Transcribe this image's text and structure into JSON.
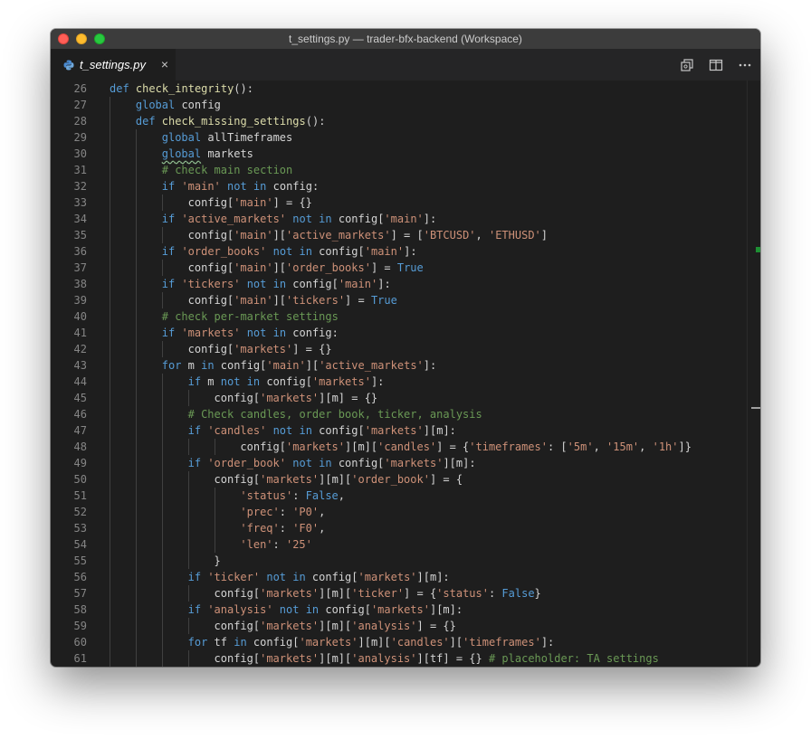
{
  "window": {
    "title": "t_settings.py — trader-bfx-backend (Workspace)"
  },
  "tab": {
    "label": "t_settings.py",
    "close": "×"
  },
  "editor": {
    "lines": [
      {
        "n": "26",
        "indent": 0,
        "tokens": [
          [
            "kw",
            "def"
          ],
          [
            "var",
            " "
          ],
          [
            "fn",
            "check_integrity"
          ],
          [
            "var",
            "():"
          ]
        ]
      },
      {
        "n": "27",
        "indent": 1,
        "tokens": [
          [
            "kw",
            "global"
          ],
          [
            "var",
            " config"
          ]
        ]
      },
      {
        "n": "28",
        "indent": 1,
        "tokens": [
          [
            "kw",
            "def"
          ],
          [
            "var",
            " "
          ],
          [
            "fn",
            "check_missing_settings"
          ],
          [
            "var",
            "():"
          ]
        ]
      },
      {
        "n": "29",
        "indent": 2,
        "tokens": [
          [
            "kw",
            "global"
          ],
          [
            "var",
            " allTimeframes"
          ]
        ]
      },
      {
        "n": "30",
        "indent": 2,
        "tokens": [
          [
            "kw squiggle",
            "global"
          ],
          [
            "var",
            " markets"
          ]
        ]
      },
      {
        "n": "31",
        "indent": 2,
        "tokens": [
          [
            "cm",
            "# check main section"
          ]
        ]
      },
      {
        "n": "32",
        "indent": 2,
        "tokens": [
          [
            "kw",
            "if"
          ],
          [
            "var",
            " "
          ],
          [
            "str",
            "'main'"
          ],
          [
            "var",
            " "
          ],
          [
            "kw",
            "not in"
          ],
          [
            "var",
            " config:"
          ]
        ]
      },
      {
        "n": "33",
        "indent": 3,
        "tokens": [
          [
            "var",
            "config["
          ],
          [
            "str",
            "'main'"
          ],
          [
            "var",
            "] = {}"
          ]
        ]
      },
      {
        "n": "34",
        "indent": 2,
        "tokens": [
          [
            "kw",
            "if"
          ],
          [
            "var",
            " "
          ],
          [
            "str",
            "'active_markets'"
          ],
          [
            "var",
            " "
          ],
          [
            "kw",
            "not in"
          ],
          [
            "var",
            " config["
          ],
          [
            "str",
            "'main'"
          ],
          [
            "var",
            "]:"
          ]
        ]
      },
      {
        "n": "35",
        "indent": 3,
        "tokens": [
          [
            "var",
            "config["
          ],
          [
            "str",
            "'main'"
          ],
          [
            "var",
            "]["
          ],
          [
            "str",
            "'active_markets'"
          ],
          [
            "var",
            "] = ["
          ],
          [
            "str",
            "'BTCUSD'"
          ],
          [
            "var",
            ", "
          ],
          [
            "str",
            "'ETHUSD'"
          ],
          [
            "var",
            "]"
          ]
        ]
      },
      {
        "n": "36",
        "indent": 2,
        "tokens": [
          [
            "kw",
            "if"
          ],
          [
            "var",
            " "
          ],
          [
            "str",
            "'order_books'"
          ],
          [
            "var",
            " "
          ],
          [
            "kw",
            "not in"
          ],
          [
            "var",
            " config["
          ],
          [
            "str",
            "'main'"
          ],
          [
            "var",
            "]:"
          ]
        ]
      },
      {
        "n": "37",
        "indent": 3,
        "tokens": [
          [
            "var",
            "config["
          ],
          [
            "str",
            "'main'"
          ],
          [
            "var",
            "]["
          ],
          [
            "str",
            "'order_books'"
          ],
          [
            "var",
            "] = "
          ],
          [
            "kw",
            "True"
          ]
        ]
      },
      {
        "n": "38",
        "indent": 2,
        "tokens": [
          [
            "kw",
            "if"
          ],
          [
            "var",
            " "
          ],
          [
            "str",
            "'tickers'"
          ],
          [
            "var",
            " "
          ],
          [
            "kw",
            "not in"
          ],
          [
            "var",
            " config["
          ],
          [
            "str",
            "'main'"
          ],
          [
            "var",
            "]:"
          ]
        ]
      },
      {
        "n": "39",
        "indent": 3,
        "tokens": [
          [
            "var",
            "config["
          ],
          [
            "str",
            "'main'"
          ],
          [
            "var",
            "]["
          ],
          [
            "str",
            "'tickers'"
          ],
          [
            "var",
            "] = "
          ],
          [
            "kw",
            "True"
          ]
        ]
      },
      {
        "n": "40",
        "indent": 2,
        "tokens": [
          [
            "cm",
            "# check per-market settings"
          ]
        ]
      },
      {
        "n": "41",
        "indent": 2,
        "tokens": [
          [
            "kw",
            "if"
          ],
          [
            "var",
            " "
          ],
          [
            "str",
            "'markets'"
          ],
          [
            "var",
            " "
          ],
          [
            "kw",
            "not in"
          ],
          [
            "var",
            " config:"
          ]
        ]
      },
      {
        "n": "42",
        "indent": 3,
        "tokens": [
          [
            "var",
            "config["
          ],
          [
            "str",
            "'markets'"
          ],
          [
            "var",
            "] = {}"
          ]
        ]
      },
      {
        "n": "43",
        "indent": 2,
        "tokens": [
          [
            "kw",
            "for"
          ],
          [
            "var",
            " m "
          ],
          [
            "kw",
            "in"
          ],
          [
            "var",
            " config["
          ],
          [
            "str",
            "'main'"
          ],
          [
            "var",
            "]["
          ],
          [
            "str",
            "'active_markets'"
          ],
          [
            "var",
            "]:"
          ]
        ]
      },
      {
        "n": "44",
        "indent": 3,
        "tokens": [
          [
            "kw",
            "if"
          ],
          [
            "var",
            " m "
          ],
          [
            "kw",
            "not in"
          ],
          [
            "var",
            " config["
          ],
          [
            "str",
            "'markets'"
          ],
          [
            "var",
            "]:"
          ]
        ]
      },
      {
        "n": "45",
        "indent": 4,
        "tokens": [
          [
            "var",
            "config["
          ],
          [
            "str",
            "'markets'"
          ],
          [
            "var",
            "][m] = {}"
          ]
        ]
      },
      {
        "n": "46",
        "indent": 3,
        "tokens": [
          [
            "cm",
            "# Check candles, order book, ticker, analysis"
          ]
        ]
      },
      {
        "n": "47",
        "indent": 3,
        "tokens": [
          [
            "kw",
            "if"
          ],
          [
            "var",
            " "
          ],
          [
            "str",
            "'candles'"
          ],
          [
            "var",
            " "
          ],
          [
            "kw",
            "not in"
          ],
          [
            "var",
            " config["
          ],
          [
            "str",
            "'markets'"
          ],
          [
            "var",
            "][m]:"
          ]
        ]
      },
      {
        "n": "48",
        "indent": 5,
        "tokens": [
          [
            "var",
            "config["
          ],
          [
            "str",
            "'markets'"
          ],
          [
            "var",
            "][m]["
          ],
          [
            "str",
            "'candles'"
          ],
          [
            "var",
            "] = {"
          ],
          [
            "str",
            "'timeframes'"
          ],
          [
            "var",
            ": ["
          ],
          [
            "str",
            "'5m'"
          ],
          [
            "var",
            ", "
          ],
          [
            "str",
            "'15m'"
          ],
          [
            "var",
            ", "
          ],
          [
            "str",
            "'1h'"
          ],
          [
            "var",
            "]}"
          ]
        ]
      },
      {
        "n": "49",
        "indent": 3,
        "tokens": [
          [
            "kw",
            "if"
          ],
          [
            "var",
            " "
          ],
          [
            "str",
            "'order_book'"
          ],
          [
            "var",
            " "
          ],
          [
            "kw",
            "not in"
          ],
          [
            "var",
            " config["
          ],
          [
            "str",
            "'markets'"
          ],
          [
            "var",
            "][m]:"
          ]
        ]
      },
      {
        "n": "50",
        "indent": 4,
        "tokens": [
          [
            "var",
            "config["
          ],
          [
            "str",
            "'markets'"
          ],
          [
            "var",
            "][m]["
          ],
          [
            "str",
            "'order_book'"
          ],
          [
            "var",
            "] = {"
          ]
        ]
      },
      {
        "n": "51",
        "indent": 5,
        "tokens": [
          [
            "str",
            "'status'"
          ],
          [
            "var",
            ": "
          ],
          [
            "kw",
            "False"
          ],
          [
            "var",
            ","
          ]
        ]
      },
      {
        "n": "52",
        "indent": 5,
        "tokens": [
          [
            "str",
            "'prec'"
          ],
          [
            "var",
            ": "
          ],
          [
            "str",
            "'P0'"
          ],
          [
            "var",
            ","
          ]
        ]
      },
      {
        "n": "53",
        "indent": 5,
        "tokens": [
          [
            "str",
            "'freq'"
          ],
          [
            "var",
            ": "
          ],
          [
            "str",
            "'F0'"
          ],
          [
            "var",
            ","
          ]
        ]
      },
      {
        "n": "54",
        "indent": 5,
        "tokens": [
          [
            "str",
            "'len'"
          ],
          [
            "var",
            ": "
          ],
          [
            "str",
            "'25'"
          ]
        ]
      },
      {
        "n": "55",
        "indent": 4,
        "tokens": [
          [
            "var",
            "}"
          ]
        ]
      },
      {
        "n": "56",
        "indent": 3,
        "tokens": [
          [
            "kw",
            "if"
          ],
          [
            "var",
            " "
          ],
          [
            "str",
            "'ticker'"
          ],
          [
            "var",
            " "
          ],
          [
            "kw",
            "not in"
          ],
          [
            "var",
            " config["
          ],
          [
            "str",
            "'markets'"
          ],
          [
            "var",
            "][m]:"
          ]
        ]
      },
      {
        "n": "57",
        "indent": 4,
        "tokens": [
          [
            "var",
            "config["
          ],
          [
            "str",
            "'markets'"
          ],
          [
            "var",
            "][m]["
          ],
          [
            "str",
            "'ticker'"
          ],
          [
            "var",
            "] = {"
          ],
          [
            "str",
            "'status'"
          ],
          [
            "var",
            ": "
          ],
          [
            "kw",
            "False"
          ],
          [
            "var",
            "}"
          ]
        ]
      },
      {
        "n": "58",
        "indent": 3,
        "tokens": [
          [
            "kw",
            "if"
          ],
          [
            "var",
            " "
          ],
          [
            "str",
            "'analysis'"
          ],
          [
            "var",
            " "
          ],
          [
            "kw",
            "not in"
          ],
          [
            "var",
            " config["
          ],
          [
            "str",
            "'markets'"
          ],
          [
            "var",
            "][m]:"
          ]
        ]
      },
      {
        "n": "59",
        "indent": 4,
        "tokens": [
          [
            "var",
            "config["
          ],
          [
            "str",
            "'markets'"
          ],
          [
            "var",
            "][m]["
          ],
          [
            "str",
            "'analysis'"
          ],
          [
            "var",
            "] = {}"
          ]
        ]
      },
      {
        "n": "60",
        "indent": 3,
        "tokens": [
          [
            "kw",
            "for"
          ],
          [
            "var",
            " tf "
          ],
          [
            "kw",
            "in"
          ],
          [
            "var",
            " config["
          ],
          [
            "str",
            "'markets'"
          ],
          [
            "var",
            "][m]["
          ],
          [
            "str",
            "'candles'"
          ],
          [
            "var",
            "]["
          ],
          [
            "str",
            "'timeframes'"
          ],
          [
            "var",
            "]:"
          ]
        ]
      },
      {
        "n": "61",
        "indent": 4,
        "tokens": [
          [
            "var",
            "config["
          ],
          [
            "str",
            "'markets'"
          ],
          [
            "var",
            "][m]["
          ],
          [
            "str",
            "'analysis'"
          ],
          [
            "var",
            "][tf] = {} "
          ],
          [
            "cm",
            "# placeholder: TA settings"
          ]
        ]
      }
    ]
  }
}
